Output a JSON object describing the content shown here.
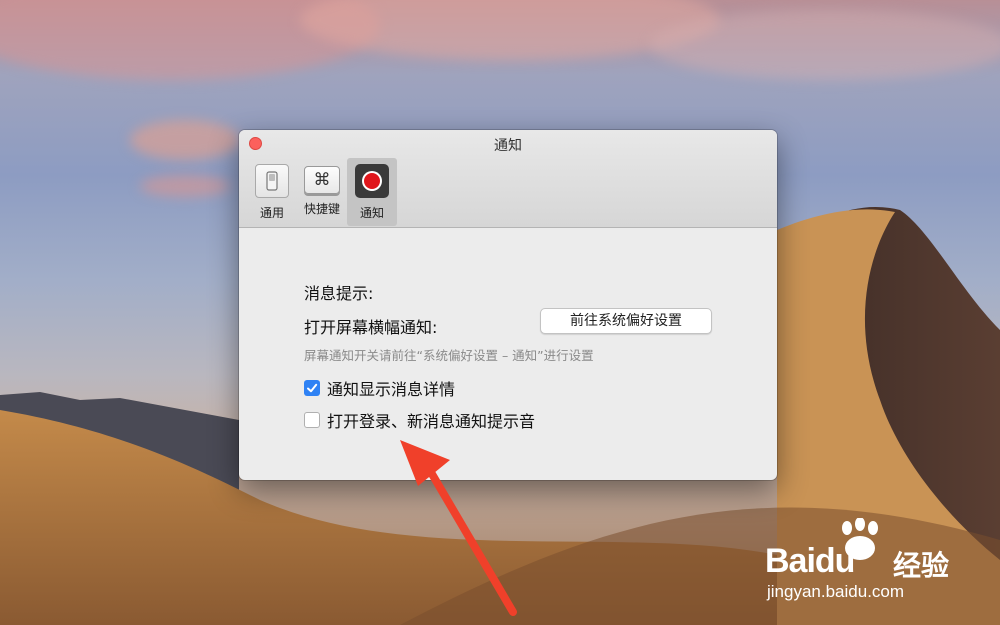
{
  "window": {
    "title": "通知",
    "toolbar": [
      {
        "label": "通用",
        "icon": "switch-icon"
      },
      {
        "label": "快捷键",
        "icon": "command-key-icon",
        "glyph": "⌘"
      },
      {
        "label": "通知",
        "icon": "record-icon"
      }
    ],
    "active_tab": "通知"
  },
  "content": {
    "section_label": "消息提示:",
    "banner_label": "打开屏幕横幅通知:",
    "pref_button": "前往系统偏好设置",
    "hint": "屏幕通知开关请前往“系统偏好设置 – 通知”进行设置",
    "options": [
      {
        "label": "通知显示消息详情",
        "checked": true
      },
      {
        "label": "打开登录、新消息通知提示音",
        "checked": false
      }
    ]
  },
  "watermark": {
    "brand": "Baidu",
    "cn": "经验",
    "url": "jingyan.baidu.com"
  },
  "colors": {
    "accent": "#2f82f4",
    "arrow": "#f0402a",
    "close": "#fc605c"
  }
}
